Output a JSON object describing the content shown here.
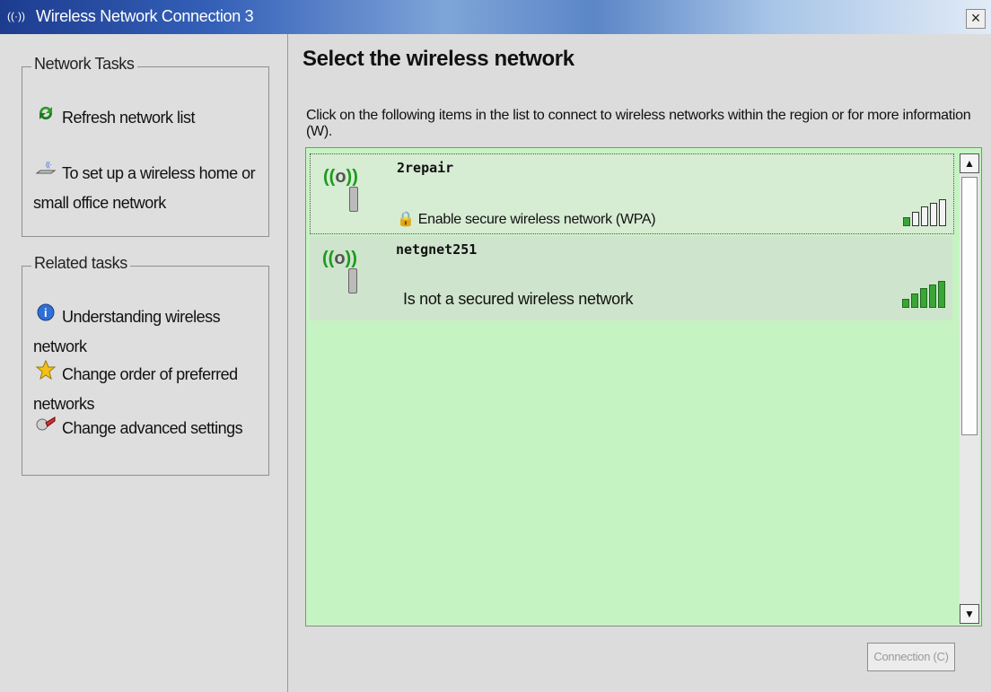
{
  "window": {
    "title": "Wireless Network Connection 3",
    "close_label": "×"
  },
  "network_tasks": {
    "title": "Network Tasks",
    "items": [
      {
        "label": "Refresh network list",
        "icon": "refresh-icon"
      },
      {
        "label": "To set up a wireless home or small office network",
        "icon": "setup-icon"
      }
    ]
  },
  "related_tasks": {
    "title": "Related tasks",
    "items": [
      {
        "label": "Understanding wireless network",
        "icon": "info-icon"
      },
      {
        "label": "Change order of preferred networks",
        "icon": "star-icon"
      },
      {
        "label": "Change advanced settings",
        "icon": "settings-icon"
      }
    ]
  },
  "main": {
    "heading": "Select the wireless network",
    "instruction": "Click on the following items in the list to connect to wireless networks within the region or for more information (W).",
    "networks": [
      {
        "ssid": "2repair",
        "status": "Enable secure wireless network (WPA)",
        "secured": true,
        "signal_bars": 1
      },
      {
        "ssid": "netgnet251",
        "status": "Is not a secured wireless network",
        "secured": false,
        "signal_bars": 5
      }
    ],
    "connect_label": "Connection (C)"
  },
  "colors": {
    "list_bg": "#c6f3c2",
    "signal_on": "#3aa636",
    "title_bar": "#3561b9"
  }
}
